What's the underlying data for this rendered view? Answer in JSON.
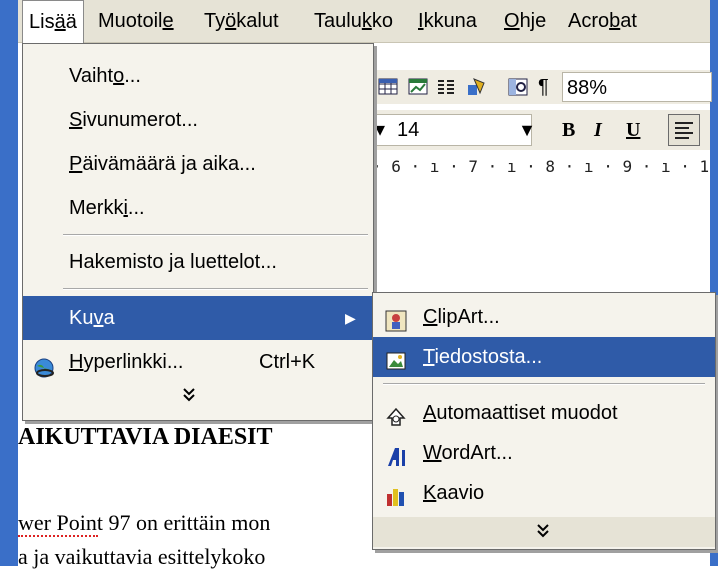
{
  "menubar": {
    "items": [
      "Lisää",
      "Muotoile",
      "Työkalut",
      "Taulukko",
      "Ikkuna",
      "Ohje",
      "Acrobat"
    ]
  },
  "toolbar": {
    "zoom": "88%",
    "font_size": "14",
    "pilcrow": "¶",
    "bold": "B",
    "italic": "I",
    "underline": "U",
    "ruler": "· 6 · ı · 7 · ı · 8 · ı · 9 · ı · 1"
  },
  "insert_menu": {
    "items": [
      {
        "label": "Vaihto..."
      },
      {
        "label": "Sivunumerot..."
      },
      {
        "label": "Päivämäärä ja aika..."
      },
      {
        "label": "Merkki..."
      },
      {
        "label": "Hakemisto ja luettelot..."
      },
      {
        "label": "Kuva"
      },
      {
        "label": "Hyperlinkki...",
        "shortcut": "Ctrl+K"
      }
    ],
    "more": "⌄"
  },
  "picture_submenu": {
    "items": [
      {
        "label": "ClipArt...",
        "icon": "clipart-icon"
      },
      {
        "label": "Tiedostosta...",
        "icon": "from-file-icon"
      },
      {
        "label": "Automaattiset muodot",
        "icon": "autoshapes-icon"
      },
      {
        "label": "WordArt...",
        "icon": "wordart-icon"
      },
      {
        "label": "Kaavio",
        "icon": "chart-icon"
      }
    ],
    "more": "⌄"
  },
  "document": {
    "heading": "AIKUTTAVIA DIAESIT",
    "line1": "wer Point 97 on erittäin mon",
    "line2": "a ja vaikuttavia esittelykoko"
  },
  "colors": {
    "highlight": "#2f5ba8",
    "menu_bg": "#f5f3ec",
    "frame": "#3a6fc8"
  }
}
